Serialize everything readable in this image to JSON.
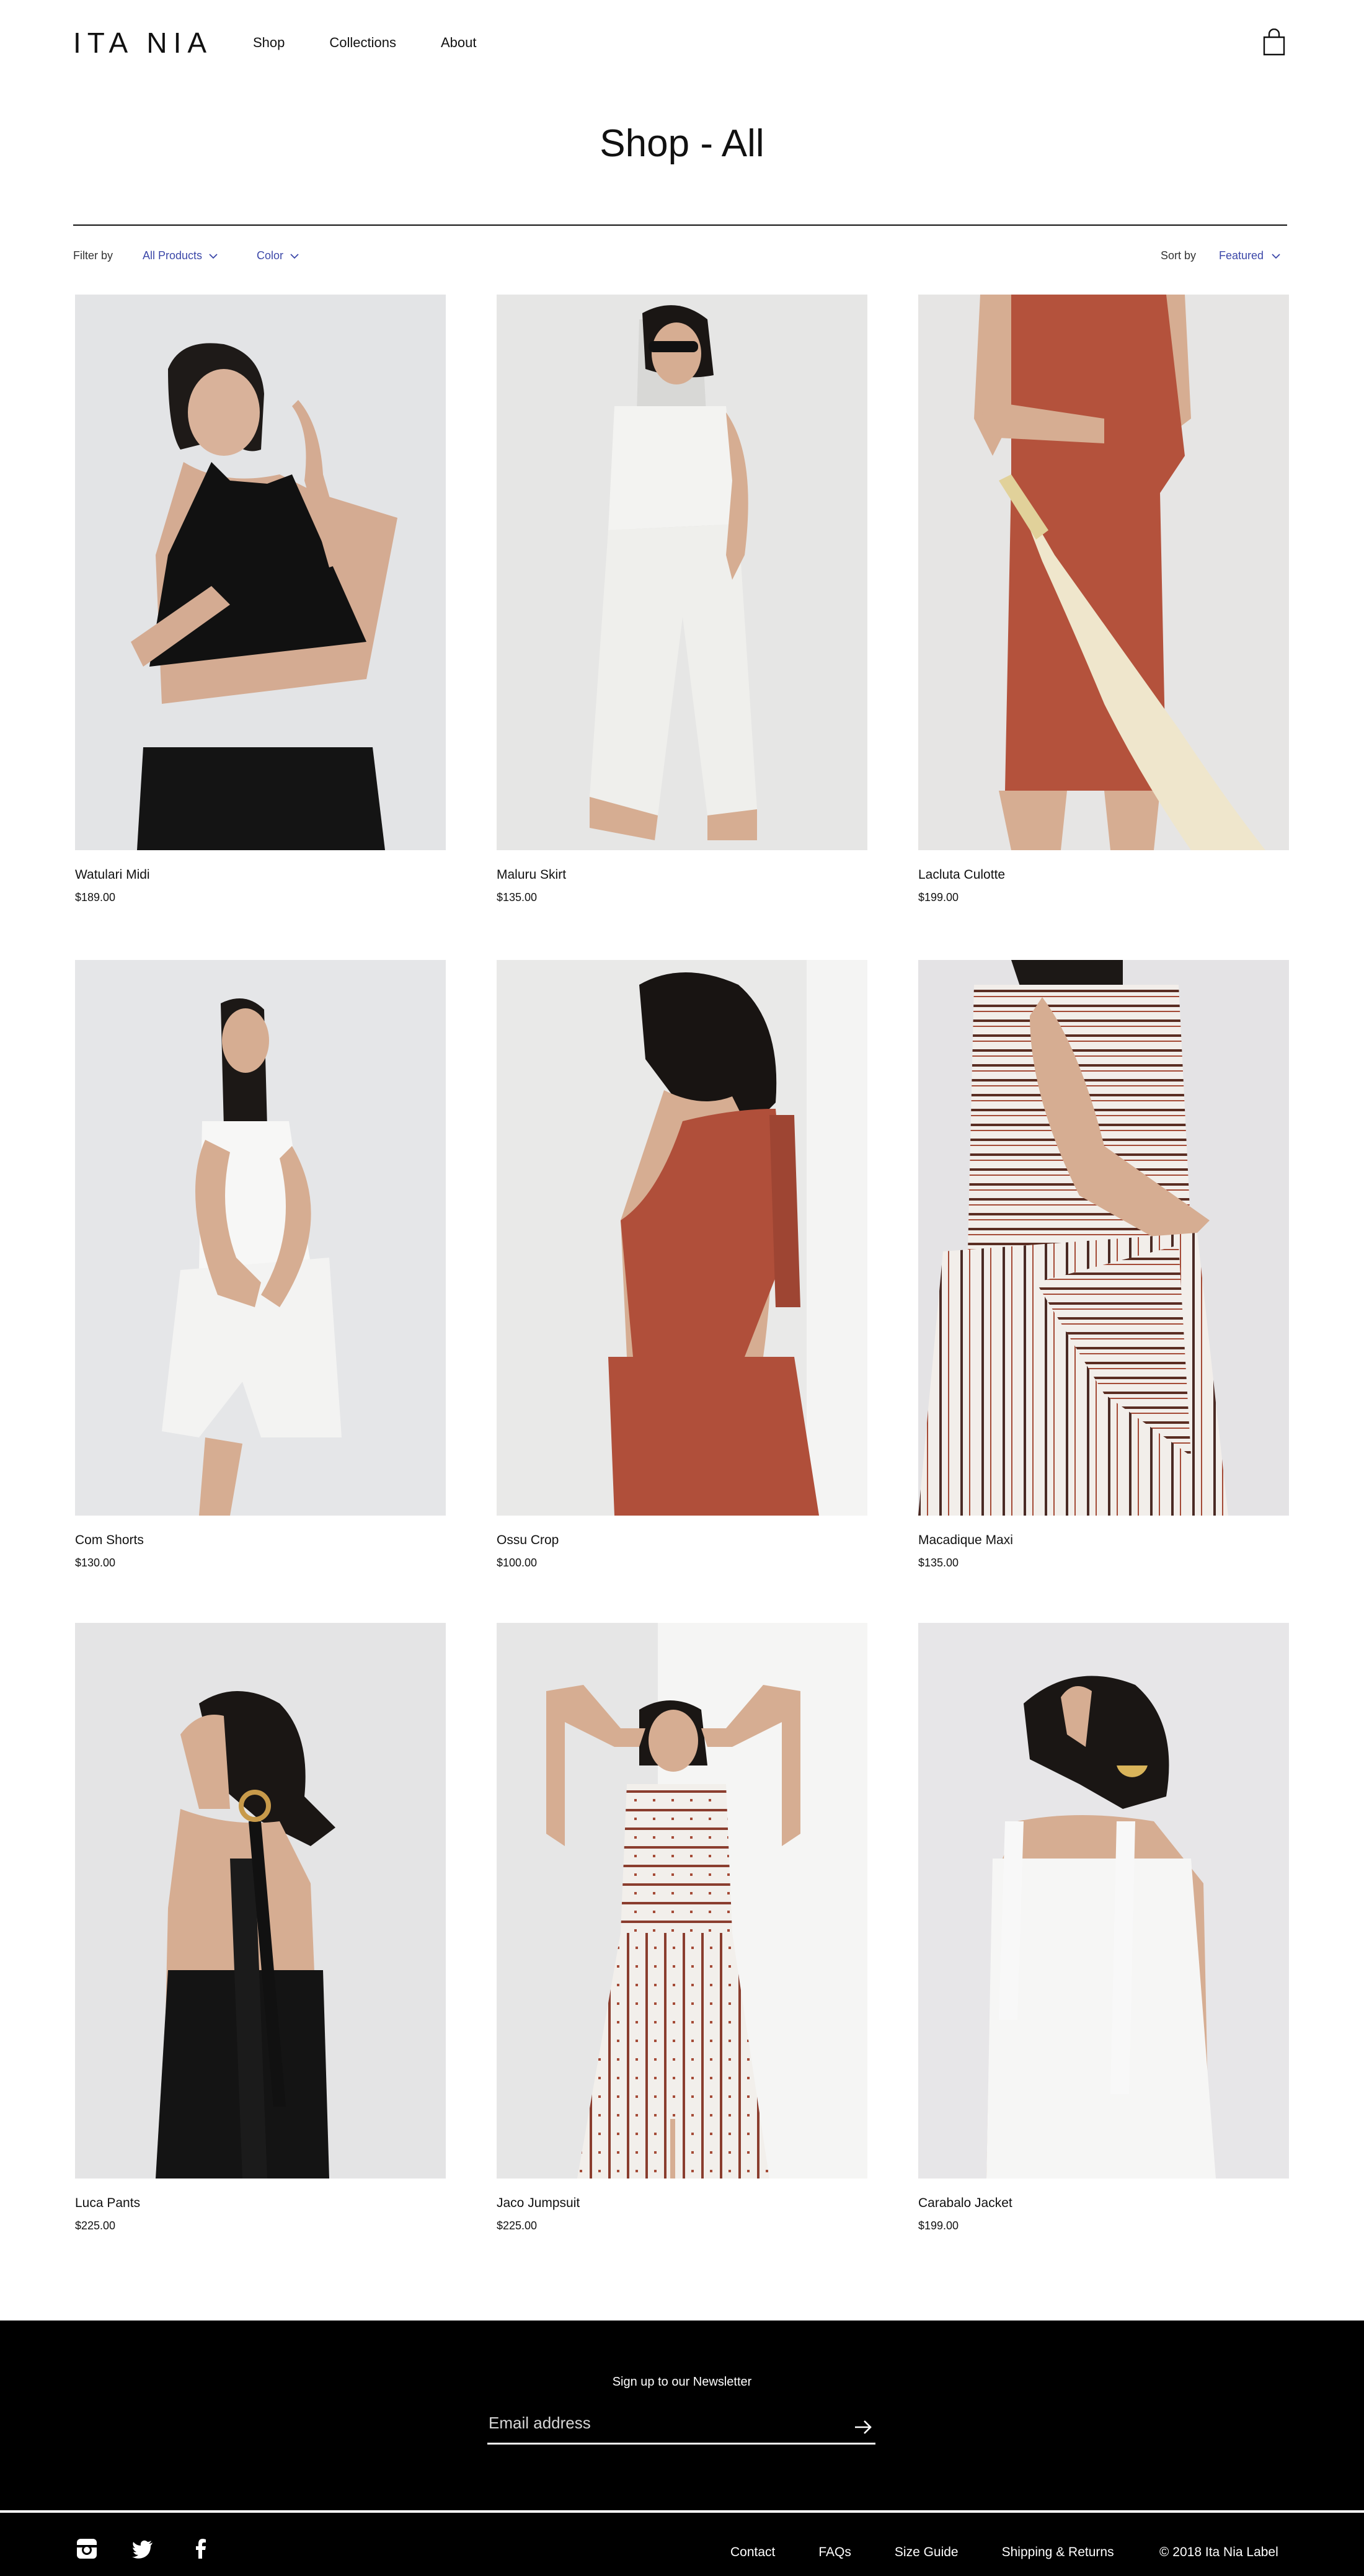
{
  "header": {
    "logo": "ITA NIA",
    "nav": [
      "Shop",
      "Collections",
      "About"
    ]
  },
  "page_title": "Shop - All",
  "filter": {
    "label": "Filter by",
    "products_value": "All Products",
    "color_value": "Color",
    "sort_label": "Sort by",
    "sort_value": "Featured",
    "accent": "#3b47a8"
  },
  "products": [
    {
      "name": "Watulari Midi",
      "price": "$189.00"
    },
    {
      "name": "Maluru Skirt",
      "price": "$135.00"
    },
    {
      "name": "Lacluta Culotte",
      "price": "$199.00"
    },
    {
      "name": "Com Shorts",
      "price": "$130.00"
    },
    {
      "name": "Ossu Crop",
      "price": "$100.00"
    },
    {
      "name": "Macadique Maxi",
      "price": "$135.00"
    },
    {
      "name": "Luca Pants",
      "price": "$225.00"
    },
    {
      "name": "Jaco Jumpsuit",
      "price": "$225.00"
    },
    {
      "name": "Carabalo Jacket",
      "price": "$199.00"
    }
  ],
  "newsletter": {
    "title": "Sign up to our Newsletter",
    "placeholder": "Email address"
  },
  "footer": {
    "social": [
      "instagram-icon",
      "twitter-icon",
      "facebook-icon"
    ],
    "links": [
      "Contact",
      "FAQs",
      "Size Guide",
      "Shipping & Returns"
    ],
    "copyright": "© 2018 Ita Nia Label"
  }
}
